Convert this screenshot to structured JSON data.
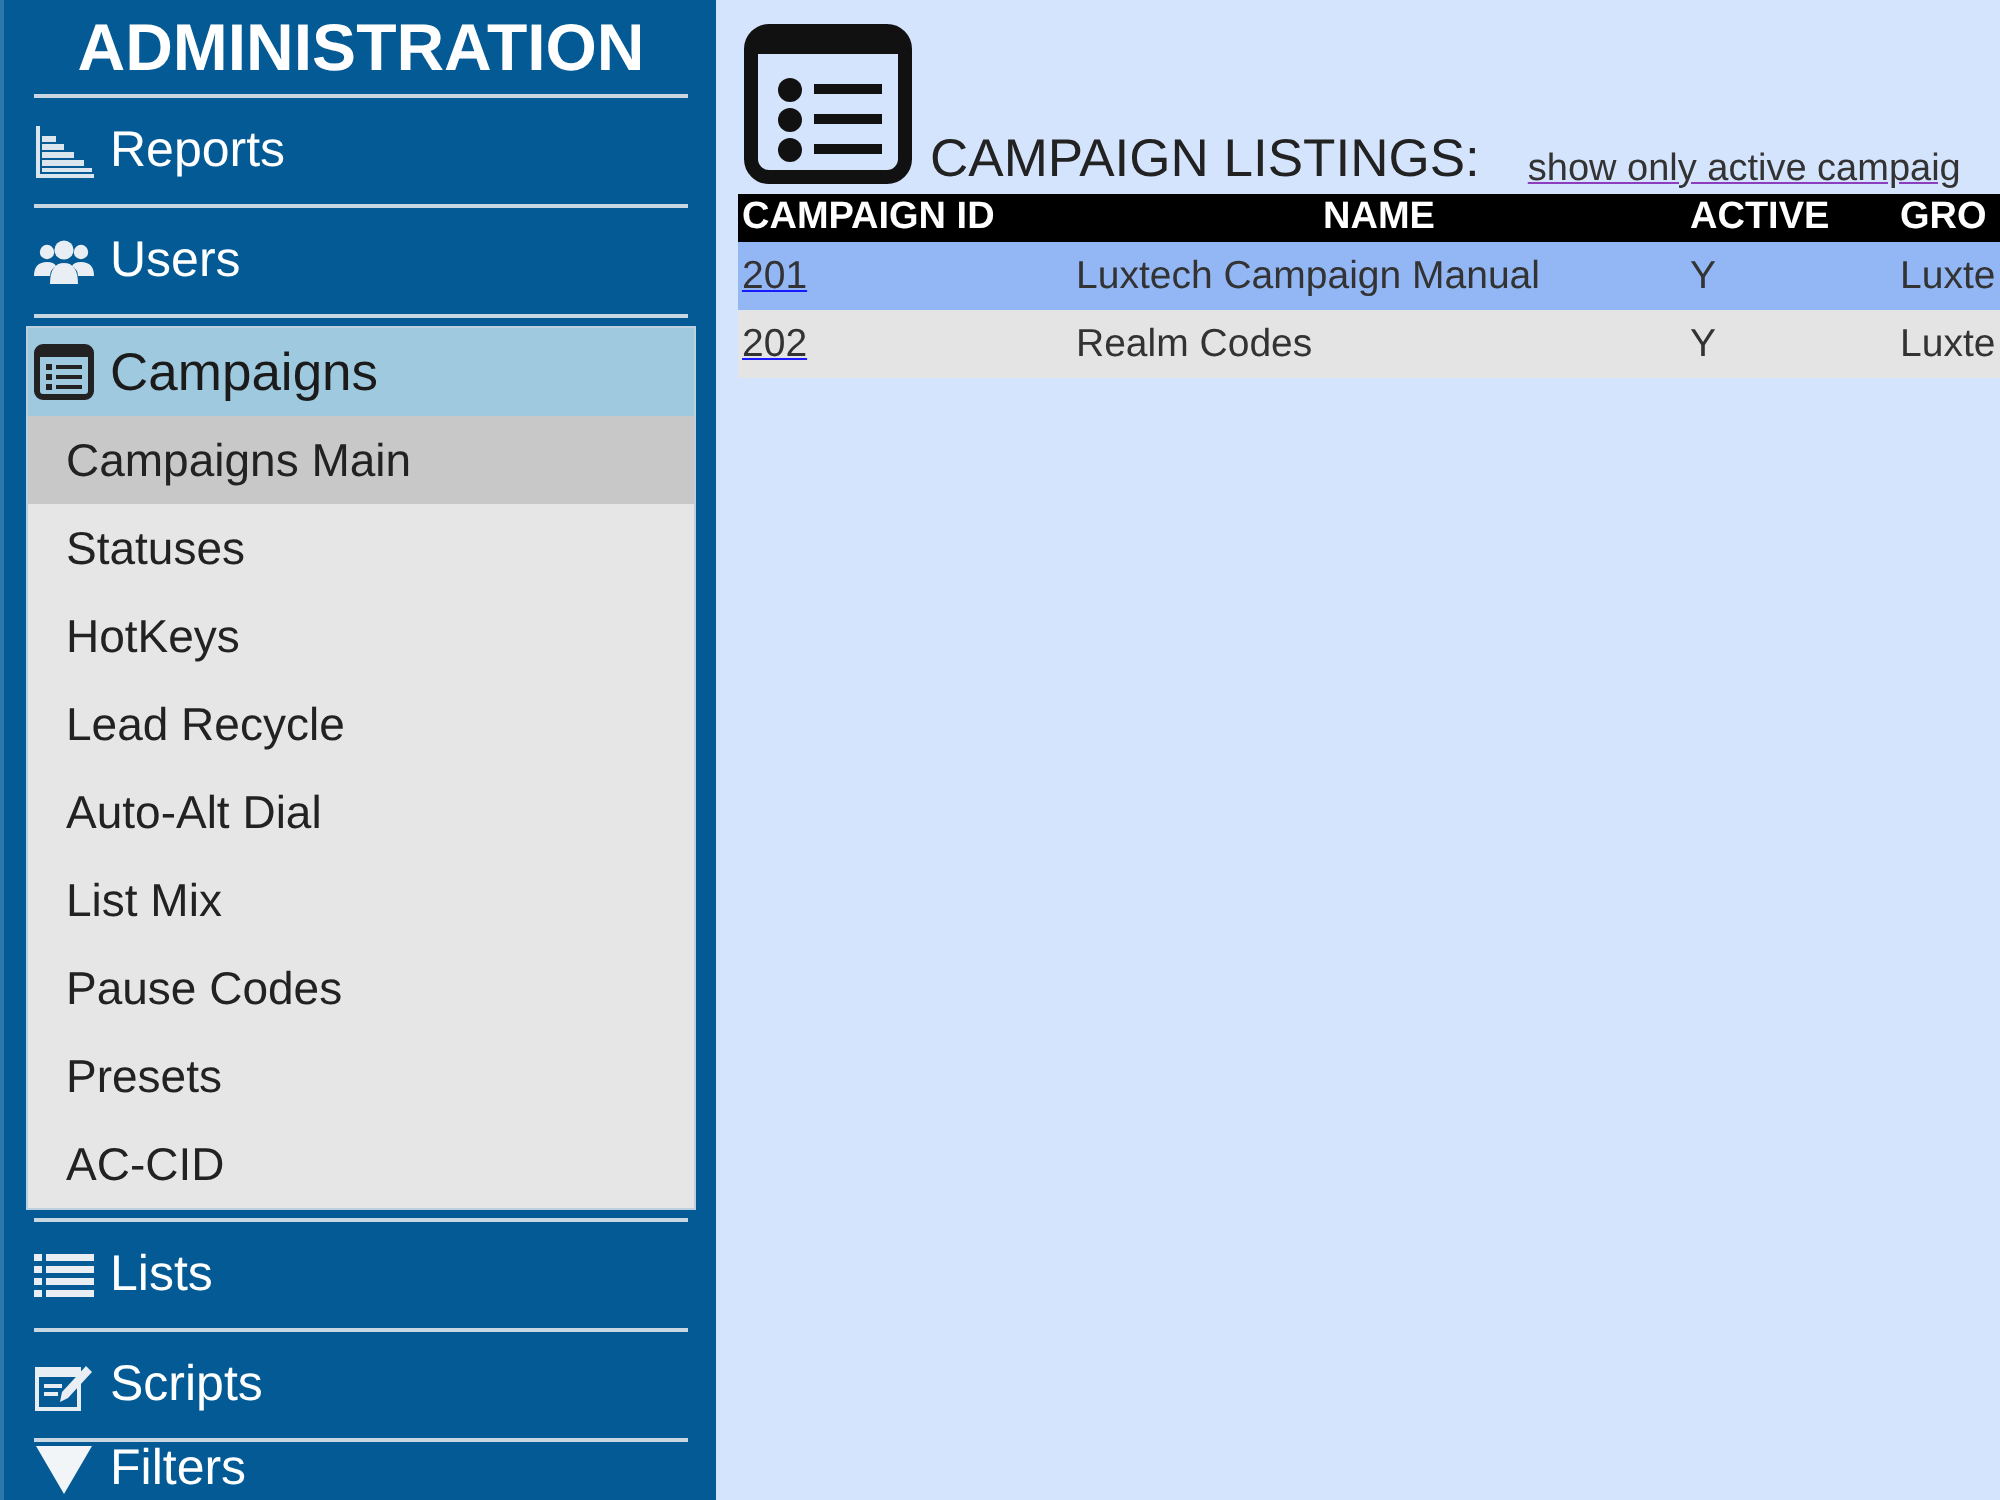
{
  "sidebar": {
    "title": "ADMINISTRATION",
    "items": [
      {
        "label": "Reports",
        "expanded": false
      },
      {
        "label": "Users",
        "expanded": false
      },
      {
        "label": "Campaigns",
        "expanded": true,
        "children": [
          {
            "label": "Campaigns Main",
            "selected": true
          },
          {
            "label": "Statuses",
            "selected": false
          },
          {
            "label": "HotKeys",
            "selected": false
          },
          {
            "label": "Lead Recycle",
            "selected": false
          },
          {
            "label": "Auto-Alt Dial",
            "selected": false
          },
          {
            "label": "List Mix",
            "selected": false
          },
          {
            "label": "Pause Codes",
            "selected": false
          },
          {
            "label": "Presets",
            "selected": false
          },
          {
            "label": "AC-CID",
            "selected": false
          }
        ]
      },
      {
        "label": "Lists",
        "expanded": false
      },
      {
        "label": "Scripts",
        "expanded": false
      },
      {
        "label": "Filters",
        "expanded": false
      }
    ]
  },
  "main": {
    "title": "CAMPAIGN LISTINGS:",
    "link": "show only active campaig",
    "table": {
      "columns": [
        "CAMPAIGN ID",
        "NAME",
        "ACTIVE",
        "GRO"
      ],
      "rows": [
        {
          "selected": true,
          "cells": [
            "201",
            "Luxtech Campaign Manual",
            "Y",
            "Luxte"
          ]
        },
        {
          "selected": false,
          "cells": [
            "202",
            "Realm Codes",
            "Y",
            "Luxte"
          ]
        }
      ]
    }
  }
}
